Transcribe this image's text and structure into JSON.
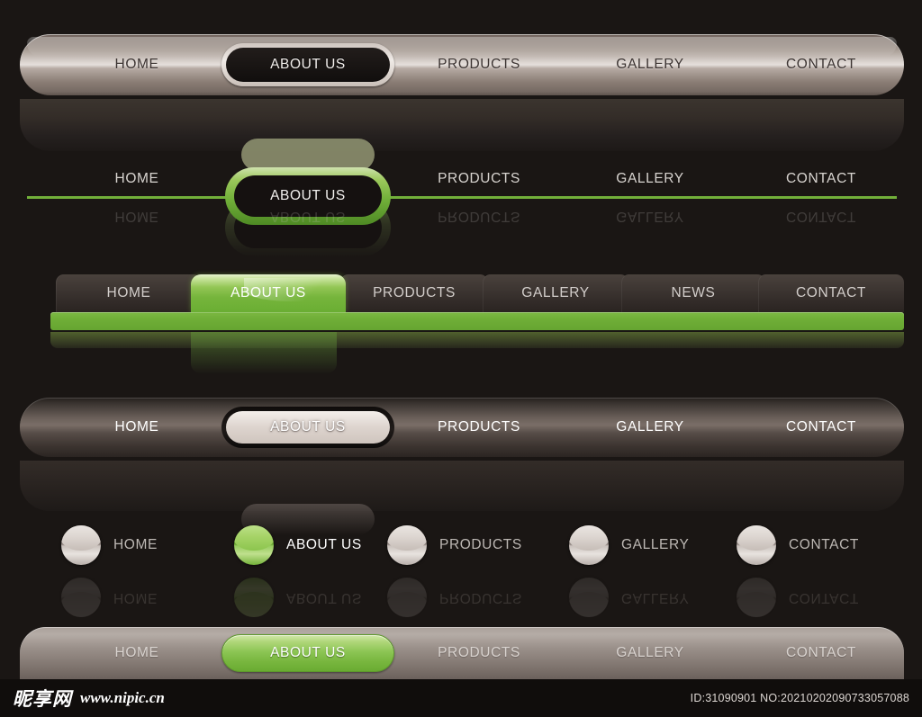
{
  "theme": {
    "background": "#1a1614",
    "accent_green": "#72b03a",
    "accent_green_light": "#9cc85c",
    "metal_light": "#e6e0dc",
    "metal_dark": "#2b2522"
  },
  "nav_bars": [
    {
      "id": "nav-metal-light",
      "style": "metallic-light-pill",
      "items": [
        {
          "label": "HOME",
          "active": false
        },
        {
          "label": "ABOUT US",
          "active": true
        },
        {
          "label": "PRODUCTS",
          "active": false
        },
        {
          "label": "GALLERY",
          "active": false
        },
        {
          "label": "CONTACT",
          "active": false
        }
      ]
    },
    {
      "id": "nav-green-line",
      "style": "green-underline-ring",
      "items": [
        {
          "label": "HOME",
          "active": false
        },
        {
          "label": "ABOUT US",
          "active": true
        },
        {
          "label": "PRODUCTS",
          "active": false
        },
        {
          "label": "GALLERY",
          "active": false
        },
        {
          "label": "CONTACT",
          "active": false
        }
      ]
    },
    {
      "id": "nav-tabs",
      "style": "tabs-green-bar",
      "items": [
        {
          "label": "HOME",
          "active": false
        },
        {
          "label": "ABOUT US",
          "active": true
        },
        {
          "label": "PRODUCTS",
          "active": false
        },
        {
          "label": "GALLERY",
          "active": false
        },
        {
          "label": "NEWS",
          "active": false
        },
        {
          "label": "CONTACT",
          "active": false
        }
      ]
    },
    {
      "id": "nav-metal-dark",
      "style": "metallic-dark-pill",
      "items": [
        {
          "label": "HOME",
          "active": false
        },
        {
          "label": "ABOUT US",
          "active": true
        },
        {
          "label": "PRODUCTS",
          "active": false
        },
        {
          "label": "GALLERY",
          "active": false
        },
        {
          "label": "CONTACT",
          "active": false
        }
      ]
    },
    {
      "id": "nav-balls",
      "style": "sphere-bullets",
      "items": [
        {
          "label": "HOME",
          "active": false
        },
        {
          "label": "ABOUT US",
          "active": true
        },
        {
          "label": "PRODUCTS",
          "active": false
        },
        {
          "label": "GALLERY",
          "active": false
        },
        {
          "label": "CONTACT",
          "active": false
        }
      ]
    },
    {
      "id": "nav-bottom",
      "style": "metallic-green-pill",
      "items": [
        {
          "label": "HOME",
          "active": false
        },
        {
          "label": "ABOUT US",
          "active": true
        },
        {
          "label": "PRODUCTS",
          "active": false
        },
        {
          "label": "GALLERY",
          "active": false
        },
        {
          "label": "CONTACT",
          "active": false
        }
      ]
    }
  ],
  "footer": {
    "watermark_cn": "昵享网",
    "watermark_url": "www.nipic.cn",
    "id_text": "ID:31090901 NO:20210202090733057088"
  }
}
